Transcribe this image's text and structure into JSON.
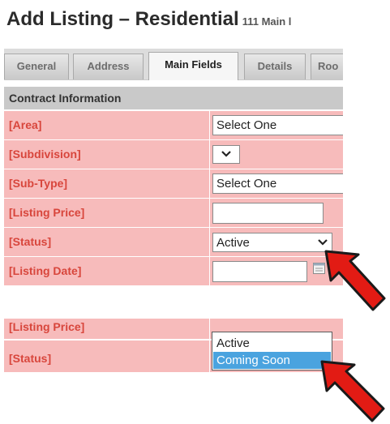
{
  "title": {
    "main": "Add Listing – Residential",
    "address": "111 Main l"
  },
  "tabs": [
    "General",
    "Address",
    "Main Fields",
    "Details",
    "Roo"
  ],
  "section": {
    "heading": "Contract Information"
  },
  "rows": [
    {
      "label": "[Area]",
      "control": "select",
      "value": "Select One"
    },
    {
      "label": "[Subdivision]",
      "control": "select",
      "value": ""
    },
    {
      "label": "[Sub-Type]",
      "control": "select",
      "value": "Select One"
    },
    {
      "label": "[Listing Price]",
      "control": "text",
      "value": ""
    },
    {
      "label": "[Status]",
      "control": "select",
      "value": "Active"
    },
    {
      "label": "[Listing Date]",
      "control": "date",
      "value": ""
    }
  ],
  "lower_rows": [
    {
      "label": "[Listing Price]"
    },
    {
      "label": "[Status]"
    }
  ],
  "dropdown": {
    "options": [
      "Active",
      "Coming Soon"
    ],
    "highlighted": "Coming Soon"
  },
  "colors": {
    "row_bg": "#f7bbbb",
    "label": "#d8463c",
    "highlight": "#4aa3df",
    "arrow": "#e21b14"
  },
  "icons": [
    "chevron-down-icon",
    "calendar-icon",
    "red-arrow-icon"
  ]
}
